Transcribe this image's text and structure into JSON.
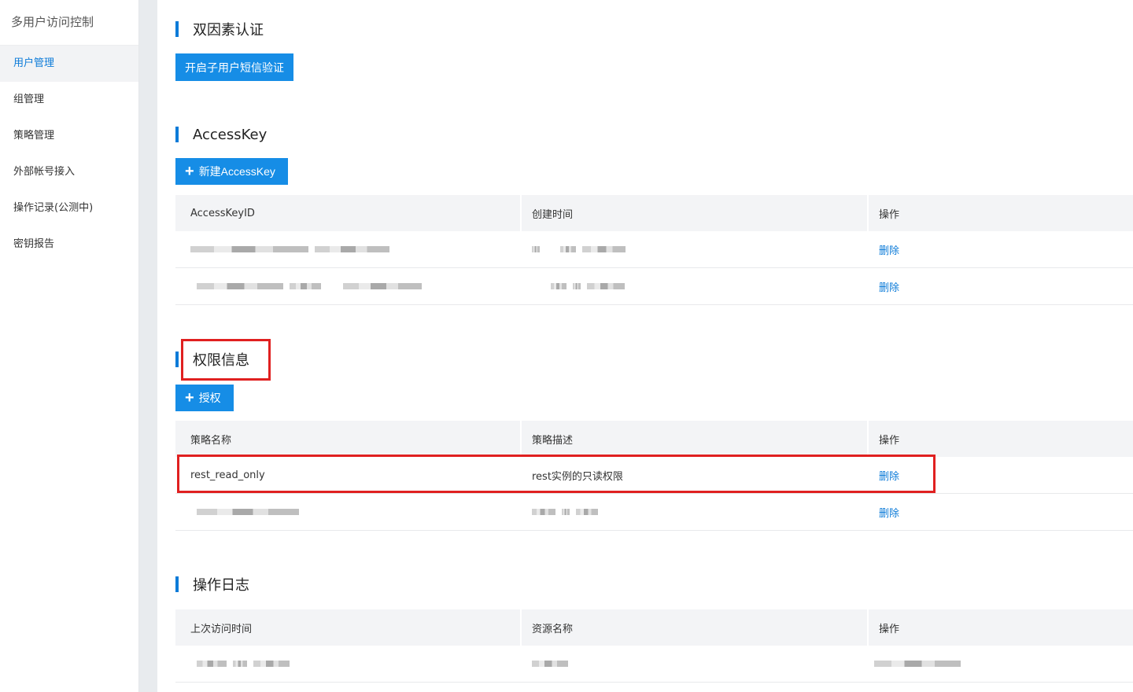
{
  "sidebar": {
    "title": "多用户访问控制",
    "items": [
      {
        "label": "用户管理",
        "active": true
      },
      {
        "label": "组管理"
      },
      {
        "label": "策略管理"
      },
      {
        "label": "外部帐号接入"
      },
      {
        "label": "操作记录(公测中)"
      },
      {
        "label": "密钥报告"
      }
    ]
  },
  "mfa": {
    "title": "双因素认证",
    "button": "开启子用户短信验证"
  },
  "accesskey": {
    "title": "AccessKey",
    "button": "新建AccessKey",
    "columns": [
      "AccessKeyID",
      "创建时间",
      "操作"
    ],
    "rows": [
      {
        "action": "删除"
      },
      {
        "action": "删除"
      }
    ]
  },
  "permissions": {
    "title": "权限信息",
    "button": "授权",
    "columns": [
      "策略名称",
      "策略描述",
      "操作"
    ],
    "rows": [
      {
        "name": "rest_read_only",
        "desc": "rest实例的只读权限",
        "action": "删除"
      },
      {
        "name": "",
        "desc": "",
        "action": "删除"
      }
    ]
  },
  "logs": {
    "title": "操作日志",
    "columns": [
      "上次访问时间",
      "资源名称",
      "操作"
    ]
  },
  "colors": {
    "accent": "#168de6",
    "link": "#0c7bd8",
    "highlight": "#e02020"
  }
}
